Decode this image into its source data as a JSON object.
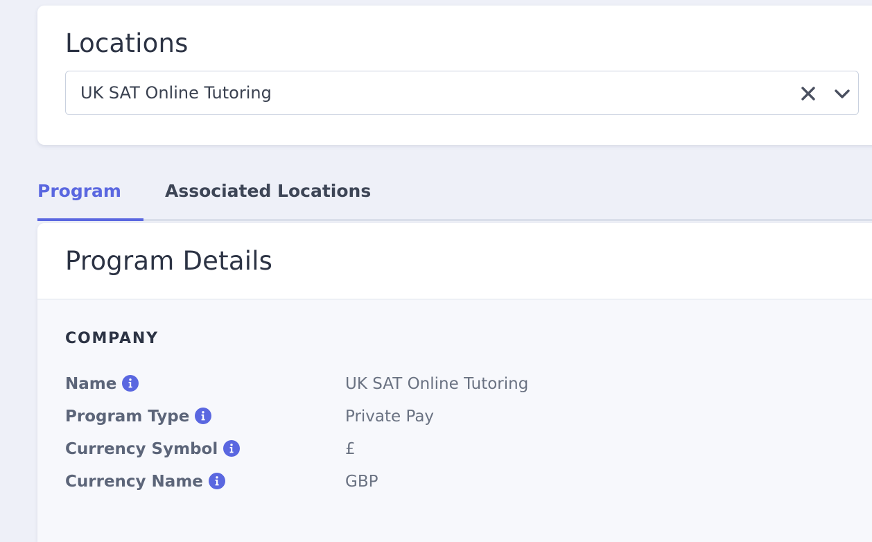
{
  "locations": {
    "title": "Locations",
    "selected_value": "UK SAT Online Tutoring",
    "clear_icon": "close-icon",
    "dropdown_icon": "chevron-down-icon"
  },
  "tabs": [
    {
      "label": "Program",
      "active": true
    },
    {
      "label": "Associated Locations",
      "active": false
    }
  ],
  "details": {
    "title": "Program Details",
    "section_title": "COMPANY",
    "fields": [
      {
        "label": "Name",
        "value": "UK SAT Online Tutoring",
        "icon": "info-icon"
      },
      {
        "label": "Program Type",
        "value": "Private Pay",
        "icon": "info-icon"
      },
      {
        "label": "Currency Symbol",
        "value": "£",
        "icon": "info-icon"
      },
      {
        "label": "Currency Name",
        "value": "GBP",
        "icon": "info-icon"
      }
    ]
  },
  "colors": {
    "accent": "#5a67e0",
    "background": "#eef0f8",
    "card": "#ffffff",
    "text_dark": "#2c3344",
    "text_label": "#5c6579",
    "text_value": "#6a7282"
  }
}
